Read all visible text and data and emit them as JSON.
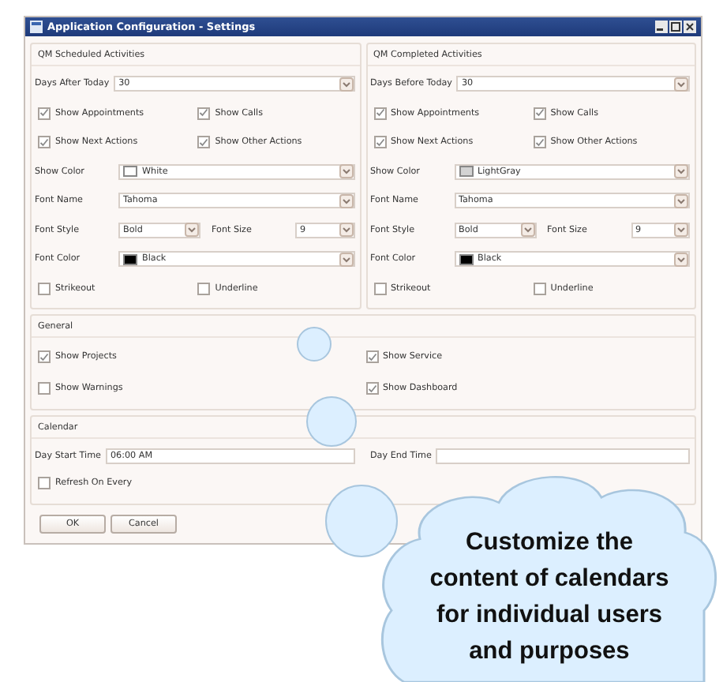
{
  "window": {
    "title": "Application Configuration - Settings"
  },
  "groups": [
    {
      "title": "QM Scheduled Activities",
      "days": {
        "label": "Days After Today",
        "value": "30"
      },
      "checkboxes": [
        {
          "label": "Show Appointments",
          "checked": true
        },
        {
          "label": "Show Calls",
          "checked": true
        },
        {
          "label": "Show Next Actions",
          "checked": true
        },
        {
          "label": "Show Other Actions",
          "checked": true
        }
      ],
      "show_color": {
        "label": "Show Color",
        "value": "White",
        "color": "#ffffff"
      },
      "font_name": {
        "label": "Font Name",
        "value": "Tahoma"
      },
      "font_style": {
        "label": "Font Style",
        "value": "Bold"
      },
      "font_size": {
        "label": "Font Size",
        "value": "9"
      },
      "font_color": {
        "label": "Font Color",
        "value": "Black",
        "color": "#000000"
      },
      "options": [
        {
          "label": "Strikeout",
          "checked": false
        },
        {
          "label": "Underline",
          "checked": false
        }
      ]
    },
    {
      "title": "QM Completed Activities",
      "days": {
        "label": "Days Before Today",
        "value": "30"
      },
      "checkboxes": [
        {
          "label": "Show Appointments",
          "checked": true
        },
        {
          "label": "Show Calls",
          "checked": true
        },
        {
          "label": "Show Next Actions",
          "checked": true
        },
        {
          "label": "Show Other Actions",
          "checked": true
        }
      ],
      "show_color": {
        "label": "Show Color",
        "value": "LightGray",
        "color": "#d3d3d3"
      },
      "font_name": {
        "label": "Font Name",
        "value": "Tahoma"
      },
      "font_style": {
        "label": "Font Style",
        "value": "Bold"
      },
      "font_size": {
        "label": "Font Size",
        "value": "9"
      },
      "font_color": {
        "label": "Font Color",
        "value": "Black",
        "color": "#000000"
      },
      "options": [
        {
          "label": "Strikeout",
          "checked": false
        },
        {
          "label": "Underline",
          "checked": false
        }
      ]
    }
  ],
  "general": {
    "title": "General",
    "checkboxes": [
      {
        "label": "Show Projects",
        "checked": true
      },
      {
        "label": "Show Service",
        "checked": true
      },
      {
        "label": "Show Warnings",
        "checked": false
      },
      {
        "label": "Show Dashboard",
        "checked": true
      }
    ]
  },
  "calendar": {
    "title": "Calendar",
    "start": {
      "label": "Day Start Time",
      "value": "06:00 AM"
    },
    "end": {
      "label": "Day End Time"
    },
    "refresh": {
      "label": "Refresh On Every",
      "checked": false
    }
  },
  "buttons": [
    "OK",
    "Cancel"
  ],
  "callout": {
    "text": "Customize the content of calendars for individual users and purposes"
  }
}
